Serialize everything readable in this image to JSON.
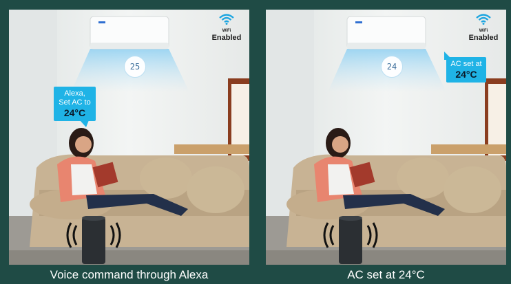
{
  "left_panel": {
    "bubble_line1": "Alexa,",
    "bubble_line2": "Set AC to",
    "bubble_temp": "24°C",
    "display_value": "25",
    "wifi_small": "WiFi",
    "wifi_big": "Enabled",
    "caption": "Voice command through Alexa"
  },
  "right_panel": {
    "bubble_line1": "AC set at",
    "bubble_temp": "24°C",
    "display_value": "24",
    "wifi_small": "WiFi",
    "wifi_big": "Enabled",
    "caption": "AC set at 24°C"
  },
  "colors": {
    "background": "#1f4b45",
    "bubble": "#1fb3e6",
    "wifi_icon": "#1fa6e0",
    "sofa": "#c8b394"
  },
  "icons": [
    "wifi-icon",
    "ac-unit-icon",
    "smart-speaker-icon",
    "sound-waves-icon"
  ]
}
